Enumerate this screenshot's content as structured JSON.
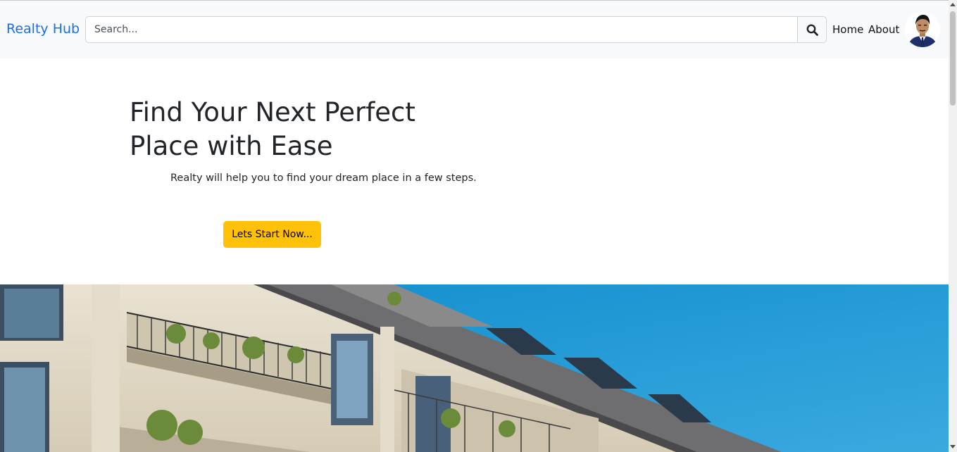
{
  "navbar": {
    "brand": "Realty Hub",
    "search": {
      "placeholder": "Search...",
      "value": ""
    },
    "search_icon": "search-icon",
    "links": [
      "Home",
      "About"
    ],
    "avatar_icon": "user-avatar"
  },
  "hero": {
    "title": "Find Your Next Perfect Place with Ease",
    "subtitle": "Realty will help you to find your dream place in a few steps.",
    "cta_label": "Lets Start Now..."
  },
  "image": {
    "subject": "apartment-building-photo"
  },
  "colors": {
    "brand": "#1a6ee8",
    "navbar_bg": "#f8f9fa",
    "cta": "#ffc107",
    "sky": "#1e9ad6"
  }
}
